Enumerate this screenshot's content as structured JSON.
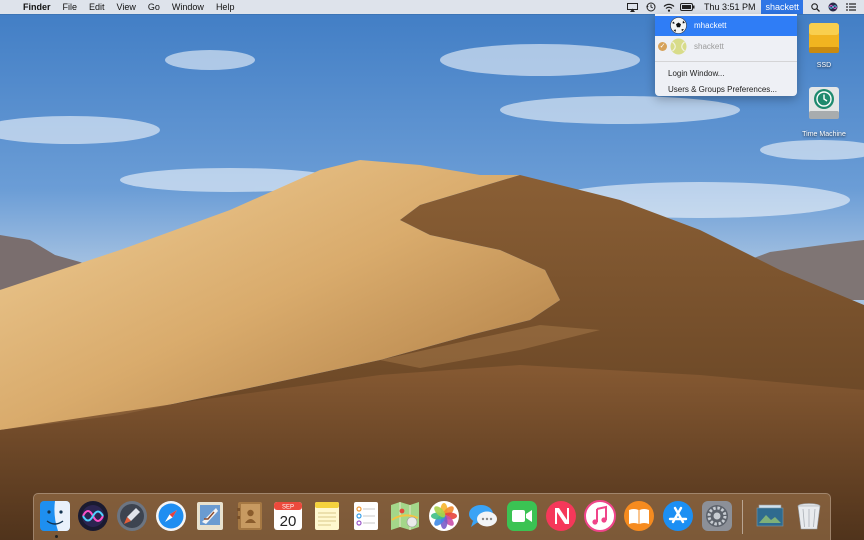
{
  "menubar": {
    "apple_glyph": "",
    "app_name": "Finder",
    "menus": [
      "File",
      "Edit",
      "View",
      "Go",
      "Window",
      "Help"
    ],
    "status_icons": [
      "airplay-icon",
      "time-machine-icon",
      "wifi-icon",
      "battery-icon"
    ],
    "clock": "Thu 3:51 PM",
    "current_user": "shackett",
    "right_icons": [
      "spotlight-icon",
      "siri-icon",
      "notification-center-icon"
    ]
  },
  "user_menu": {
    "users": [
      {
        "name": "mhackett",
        "selected": true,
        "logged_in": false
      },
      {
        "name": "shackett",
        "selected": false,
        "logged_in": true
      }
    ],
    "check_glyph": "✓",
    "items": [
      "Login Window...",
      "Users & Groups Preferences..."
    ]
  },
  "desktop": {
    "icons": [
      {
        "label": "SSD",
        "icon": "external-drive-icon"
      },
      {
        "label": "Time Machine",
        "icon": "time-machine-drive-icon"
      }
    ]
  },
  "dock": {
    "apps": [
      "Finder",
      "Siri",
      "Launchpad",
      "Safari",
      "Mail",
      "Contacts",
      "Calendar",
      "Notes",
      "Reminders",
      "Maps",
      "Photos",
      "Messages",
      "FaceTime",
      "News",
      "iTunes",
      "iBooks",
      "App Store",
      "System Preferences"
    ],
    "calendar": {
      "month": "SEP",
      "day": "20"
    },
    "right_items": [
      "Downloads",
      "Trash"
    ]
  },
  "colors": {
    "menu_highlight": "#2f76e6",
    "selected_row": "#2f7df6",
    "sky": "#5f95d3",
    "dune_light": "#e2bd86",
    "dune_dark": "#6a4526"
  }
}
